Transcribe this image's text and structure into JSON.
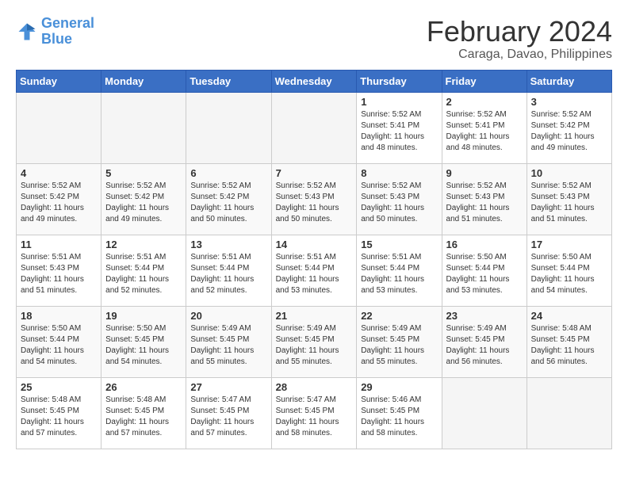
{
  "header": {
    "logo_line1": "General",
    "logo_line2": "Blue",
    "month_title": "February 2024",
    "subtitle": "Caraga, Davao, Philippines"
  },
  "days_of_week": [
    "Sunday",
    "Monday",
    "Tuesday",
    "Wednesday",
    "Thursday",
    "Friday",
    "Saturday"
  ],
  "weeks": [
    [
      {
        "day": "",
        "info": ""
      },
      {
        "day": "",
        "info": ""
      },
      {
        "day": "",
        "info": ""
      },
      {
        "day": "",
        "info": ""
      },
      {
        "day": "1",
        "info": "Sunrise: 5:52 AM\nSunset: 5:41 PM\nDaylight: 11 hours\nand 48 minutes."
      },
      {
        "day": "2",
        "info": "Sunrise: 5:52 AM\nSunset: 5:41 PM\nDaylight: 11 hours\nand 48 minutes."
      },
      {
        "day": "3",
        "info": "Sunrise: 5:52 AM\nSunset: 5:42 PM\nDaylight: 11 hours\nand 49 minutes."
      }
    ],
    [
      {
        "day": "4",
        "info": "Sunrise: 5:52 AM\nSunset: 5:42 PM\nDaylight: 11 hours\nand 49 minutes."
      },
      {
        "day": "5",
        "info": "Sunrise: 5:52 AM\nSunset: 5:42 PM\nDaylight: 11 hours\nand 49 minutes."
      },
      {
        "day": "6",
        "info": "Sunrise: 5:52 AM\nSunset: 5:42 PM\nDaylight: 11 hours\nand 50 minutes."
      },
      {
        "day": "7",
        "info": "Sunrise: 5:52 AM\nSunset: 5:43 PM\nDaylight: 11 hours\nand 50 minutes."
      },
      {
        "day": "8",
        "info": "Sunrise: 5:52 AM\nSunset: 5:43 PM\nDaylight: 11 hours\nand 50 minutes."
      },
      {
        "day": "9",
        "info": "Sunrise: 5:52 AM\nSunset: 5:43 PM\nDaylight: 11 hours\nand 51 minutes."
      },
      {
        "day": "10",
        "info": "Sunrise: 5:52 AM\nSunset: 5:43 PM\nDaylight: 11 hours\nand 51 minutes."
      }
    ],
    [
      {
        "day": "11",
        "info": "Sunrise: 5:51 AM\nSunset: 5:43 PM\nDaylight: 11 hours\nand 51 minutes."
      },
      {
        "day": "12",
        "info": "Sunrise: 5:51 AM\nSunset: 5:44 PM\nDaylight: 11 hours\nand 52 minutes."
      },
      {
        "day": "13",
        "info": "Sunrise: 5:51 AM\nSunset: 5:44 PM\nDaylight: 11 hours\nand 52 minutes."
      },
      {
        "day": "14",
        "info": "Sunrise: 5:51 AM\nSunset: 5:44 PM\nDaylight: 11 hours\nand 53 minutes."
      },
      {
        "day": "15",
        "info": "Sunrise: 5:51 AM\nSunset: 5:44 PM\nDaylight: 11 hours\nand 53 minutes."
      },
      {
        "day": "16",
        "info": "Sunrise: 5:50 AM\nSunset: 5:44 PM\nDaylight: 11 hours\nand 53 minutes."
      },
      {
        "day": "17",
        "info": "Sunrise: 5:50 AM\nSunset: 5:44 PM\nDaylight: 11 hours\nand 54 minutes."
      }
    ],
    [
      {
        "day": "18",
        "info": "Sunrise: 5:50 AM\nSunset: 5:44 PM\nDaylight: 11 hours\nand 54 minutes."
      },
      {
        "day": "19",
        "info": "Sunrise: 5:50 AM\nSunset: 5:45 PM\nDaylight: 11 hours\nand 54 minutes."
      },
      {
        "day": "20",
        "info": "Sunrise: 5:49 AM\nSunset: 5:45 PM\nDaylight: 11 hours\nand 55 minutes."
      },
      {
        "day": "21",
        "info": "Sunrise: 5:49 AM\nSunset: 5:45 PM\nDaylight: 11 hours\nand 55 minutes."
      },
      {
        "day": "22",
        "info": "Sunrise: 5:49 AM\nSunset: 5:45 PM\nDaylight: 11 hours\nand 55 minutes."
      },
      {
        "day": "23",
        "info": "Sunrise: 5:49 AM\nSunset: 5:45 PM\nDaylight: 11 hours\nand 56 minutes."
      },
      {
        "day": "24",
        "info": "Sunrise: 5:48 AM\nSunset: 5:45 PM\nDaylight: 11 hours\nand 56 minutes."
      }
    ],
    [
      {
        "day": "25",
        "info": "Sunrise: 5:48 AM\nSunset: 5:45 PM\nDaylight: 11 hours\nand 57 minutes."
      },
      {
        "day": "26",
        "info": "Sunrise: 5:48 AM\nSunset: 5:45 PM\nDaylight: 11 hours\nand 57 minutes."
      },
      {
        "day": "27",
        "info": "Sunrise: 5:47 AM\nSunset: 5:45 PM\nDaylight: 11 hours\nand 57 minutes."
      },
      {
        "day": "28",
        "info": "Sunrise: 5:47 AM\nSunset: 5:45 PM\nDaylight: 11 hours\nand 58 minutes."
      },
      {
        "day": "29",
        "info": "Sunrise: 5:46 AM\nSunset: 5:45 PM\nDaylight: 11 hours\nand 58 minutes."
      },
      {
        "day": "",
        "info": ""
      },
      {
        "day": "",
        "info": ""
      }
    ]
  ]
}
